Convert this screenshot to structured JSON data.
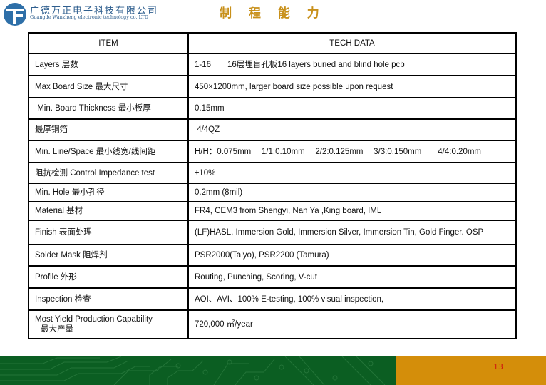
{
  "header": {
    "company_cn": "广德万正电子科技有限公司",
    "company_en": "Guangde Wanzheng electronic technology co.,LTD",
    "title": "制 程 能 力",
    "logo_icon": "company-logo-icon",
    "title_color": "#c8901a",
    "brand_color": "#2f5f8f"
  },
  "table": {
    "columns": [
      "ITEM",
      "TECH DATA"
    ],
    "rows": [
      {
        "item": "Layers 层数",
        "data": "1-16　　16层埋盲孔板16 layers buried and blind hole pcb"
      },
      {
        "item": "Max Board Size 最大尺寸",
        "data": "450×1200mm, larger board size possible upon request"
      },
      {
        "item": " Min. Board Thickness 最小板厚",
        "data": "0.15mm"
      },
      {
        "item": "最厚铜箔",
        "data": " 4/4QZ"
      },
      {
        "item": "Min. Line/Space 最小线宽/线间距",
        "data": "H/H：0.075mm　 1/1:0.10mm　 2/2:0.125mm　 3/3:0.150mm　　4/4:0.20mm"
      },
      {
        "item": "阻抗检测 Control Impedance test",
        "data": "±10%"
      },
      {
        "item": "Min. Hole 最小孔径",
        "data": "0.2mm (8mil)"
      },
      {
        "item": "Material 基材",
        "data": "FR4, CEM3 from Shengyi, Nan Ya ,King board, IML"
      },
      {
        "item": "Finish 表面处理",
        "data": "(LF)HASL, Immersion Gold, Immersion Silver, Immersion Tin, Gold Finger. OSP"
      },
      {
        "item": "Solder Mask 阻焊剂",
        "data": "PSR2000(Taiyo), PSR2200 (Tamura)"
      },
      {
        "item": "Profile 外形",
        "data": "Routing, Punching, Scoring, V-cut"
      },
      {
        "item": "Inspection 检查",
        "data": "AOI、AVI、100% E-testing, 100% visual inspection,"
      },
      {
        "item": "Most Yield Production Capability",
        "item_line2": "最大产量",
        "data": "720,000 ㎡/year"
      }
    ]
  },
  "footer": {
    "page_number": "13",
    "green_color": "#0b5e22",
    "orange_color": "#d48e0a",
    "page_number_color": "#d01a10"
  }
}
